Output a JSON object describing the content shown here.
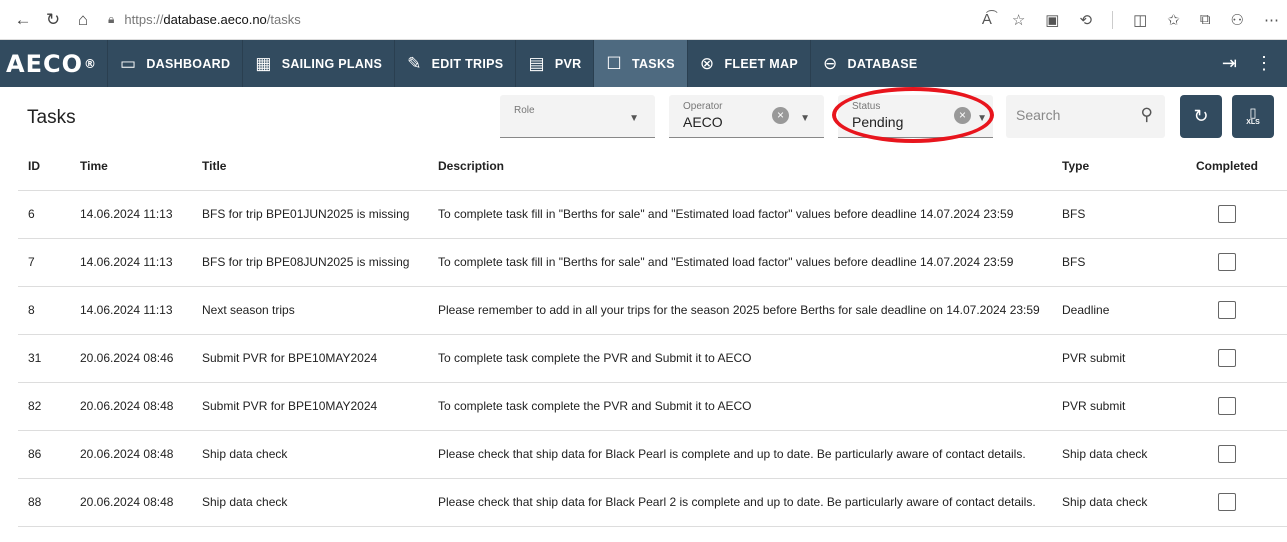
{
  "browser": {
    "url_scheme": "https://",
    "url_host": "database.aeco.no",
    "url_path": "/tasks"
  },
  "nav": {
    "logo": "AECO",
    "logo_mark": "®",
    "items": [
      {
        "label": "DASHBOARD",
        "icon": "dashboard-icon",
        "glyph": "▭"
      },
      {
        "label": "SAILING PLANS",
        "icon": "calendar-icon",
        "glyph": "▦"
      },
      {
        "label": "EDIT TRIPS",
        "icon": "edit-icon",
        "glyph": "✎"
      },
      {
        "label": "PVR",
        "icon": "clipboard-icon",
        "glyph": "▤"
      },
      {
        "label": "TASKS",
        "icon": "tasks-icon",
        "glyph": "☐",
        "active": true
      },
      {
        "label": "FLEET MAP",
        "icon": "compass-icon",
        "glyph": "⊗"
      },
      {
        "label": "DATABASE",
        "icon": "database-icon",
        "glyph": "⊖"
      }
    ]
  },
  "toolbar": {
    "title": "Tasks",
    "role": {
      "label": "Role",
      "value": ""
    },
    "operator": {
      "label": "Operator",
      "value": "AECO"
    },
    "status": {
      "label": "Status",
      "value": "Pending"
    },
    "search_placeholder": "Search",
    "xls_label": "XLS"
  },
  "table": {
    "headers": {
      "id": "ID",
      "time": "Time",
      "title": "Title",
      "description": "Description",
      "type": "Type",
      "completed": "Completed"
    },
    "rows": [
      {
        "id": "6",
        "time": "14.06.2024 11:13",
        "title": "BFS for trip BPE01JUN2025 is missing",
        "description": "To complete task fill in \"Berths for sale\" and \"Estimated load factor\" values before deadline 14.07.2024 23:59",
        "type": "BFS",
        "completed": false
      },
      {
        "id": "7",
        "time": "14.06.2024 11:13",
        "title": "BFS for trip BPE08JUN2025 is missing",
        "description": "To complete task fill in \"Berths for sale\" and \"Estimated load factor\" values before deadline 14.07.2024 23:59",
        "type": "BFS",
        "completed": false
      },
      {
        "id": "8",
        "time": "14.06.2024 11:13",
        "title": "Next season trips",
        "description": "Please remember to add in all your trips for the season 2025 before Berths for sale deadline on 14.07.2024 23:59",
        "type": "Deadline",
        "completed": false
      },
      {
        "id": "31",
        "time": "20.06.2024 08:46",
        "title": "Submit PVR for BPE10MAY2024",
        "description": "To complete task complete the PVR and Submit it to AECO",
        "type": "PVR submit",
        "completed": false
      },
      {
        "id": "82",
        "time": "20.06.2024 08:48",
        "title": "Submit PVR for BPE10MAY2024",
        "description": "To complete task complete the PVR and Submit it to AECO",
        "type": "PVR submit",
        "completed": false
      },
      {
        "id": "86",
        "time": "20.06.2024 08:48",
        "title": "Ship data check",
        "description": "Please check that ship data for Black Pearl is complete and up to date. Be particularly aware of contact details.",
        "type": "Ship data check",
        "completed": false
      },
      {
        "id": "88",
        "time": "20.06.2024 08:48",
        "title": "Ship data check",
        "description": "Please check that ship data for Black Pearl 2 is complete and up to date. Be particularly aware of contact details.",
        "type": "Ship data check",
        "completed": false
      }
    ]
  },
  "colors": {
    "nav_bg": "#324b5f",
    "nav_active": "#4e6a80",
    "highlight_ring": "#e8151d"
  }
}
